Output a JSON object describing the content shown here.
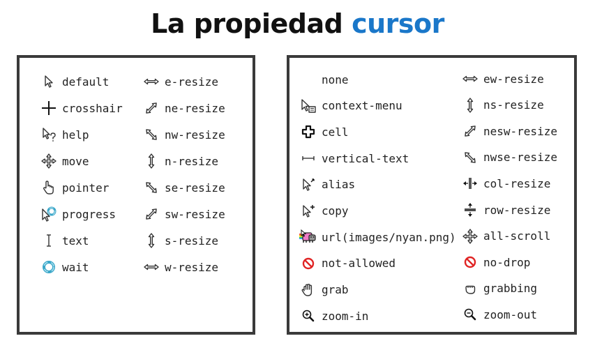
{
  "title": {
    "prefix": "La propiedad",
    "highlight": "cursor"
  },
  "left": {
    "col1": [
      {
        "label": "default",
        "icon": "arrow-icon"
      },
      {
        "label": "crosshair",
        "icon": "crosshair-icon"
      },
      {
        "label": "help",
        "icon": "help-icon"
      },
      {
        "label": "move",
        "icon": "move-icon"
      },
      {
        "label": "pointer",
        "icon": "hand-pointer-icon"
      },
      {
        "label": "progress",
        "icon": "progress-icon"
      },
      {
        "label": "text",
        "icon": "text-ibeam-icon"
      },
      {
        "label": "wait",
        "icon": "wait-ring-icon"
      }
    ],
    "col2": [
      {
        "label": "e-resize",
        "icon": "horizontal-resize-icon"
      },
      {
        "label": "ne-resize",
        "icon": "diagonal-ne-resize-icon"
      },
      {
        "label": "nw-resize",
        "icon": "diagonal-nw-resize-icon"
      },
      {
        "label": "n-resize",
        "icon": "vertical-resize-icon"
      },
      {
        "label": "se-resize",
        "icon": "diagonal-nw-resize-icon"
      },
      {
        "label": "sw-resize",
        "icon": "diagonal-ne-resize-icon"
      },
      {
        "label": "s-resize",
        "icon": "vertical-resize-icon"
      },
      {
        "label": "w-resize",
        "icon": "horizontal-resize-icon"
      }
    ]
  },
  "right": {
    "col1": [
      {
        "label": "none",
        "icon": ""
      },
      {
        "label": "context-menu",
        "icon": "context-menu-icon"
      },
      {
        "label": "cell",
        "icon": "cell-plus-icon"
      },
      {
        "label": "vertical-text",
        "icon": "vertical-text-icon"
      },
      {
        "label": "alias",
        "icon": "alias-icon"
      },
      {
        "label": "copy",
        "icon": "copy-icon"
      },
      {
        "label": "url(images/nyan.png)",
        "icon": "nyan-cat-icon"
      },
      {
        "label": "not-allowed",
        "icon": "not-allowed-icon"
      },
      {
        "label": "grab",
        "icon": "grab-hand-icon"
      },
      {
        "label": "zoom-in",
        "icon": "zoom-in-icon"
      }
    ],
    "col2": [
      {
        "label": "ew-resize",
        "icon": "horizontal-resize-icon"
      },
      {
        "label": "ns-resize",
        "icon": "vertical-resize-icon"
      },
      {
        "label": "nesw-resize",
        "icon": "diagonal-ne-resize-icon"
      },
      {
        "label": "nwse-resize",
        "icon": "diagonal-nw-resize-icon"
      },
      {
        "label": "col-resize",
        "icon": "col-resize-icon"
      },
      {
        "label": "row-resize",
        "icon": "row-resize-icon"
      },
      {
        "label": "all-scroll",
        "icon": "move-icon"
      },
      {
        "label": "no-drop",
        "icon": "not-allowed-icon"
      },
      {
        "label": "grabbing",
        "icon": "grabbing-fist-icon"
      },
      {
        "label": "zoom-out",
        "icon": "zoom-out-icon"
      }
    ]
  },
  "colors": {
    "accent": "#1a77c9",
    "border": "#3a3a3a",
    "forbidden": "#e02424",
    "wait": "#3aa6c8",
    "nyan": "#f07cc6"
  }
}
